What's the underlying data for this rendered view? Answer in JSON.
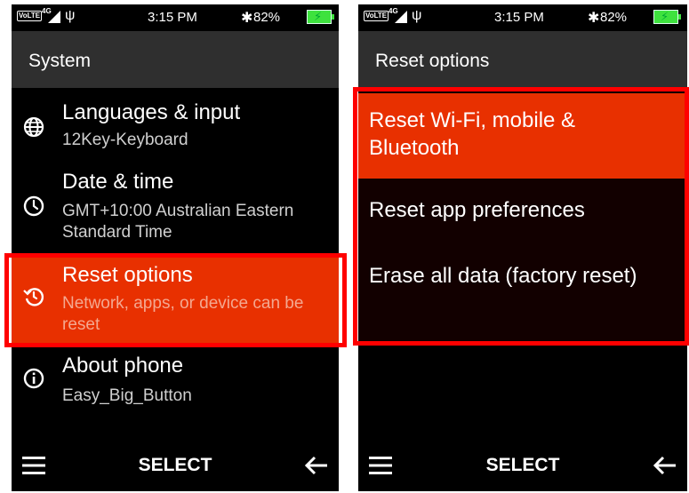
{
  "status_bar": {
    "volte": "VoLTE",
    "network": "4G",
    "time": "3:15 PM",
    "battery_percent": "82%",
    "battery_level": 0.82,
    "battery_color": "#3ee23e"
  },
  "left_screen": {
    "title": "System",
    "items": [
      {
        "title": "Languages & input",
        "subtitle": "12Key-Keyboard",
        "icon": "globe-icon"
      },
      {
        "title": "Date & time",
        "subtitle": "GMT+10:00 Australian Eastern Standard Time",
        "icon": "clock-icon"
      },
      {
        "title": "Reset options",
        "subtitle": "Network, apps, or device can be reset",
        "icon": "reset-history-icon",
        "selected": true
      },
      {
        "title": "About phone",
        "subtitle": "Easy_Big_Button",
        "icon": "info-icon"
      }
    ]
  },
  "right_screen": {
    "title": "Reset options",
    "items": [
      {
        "label": "Reset Wi-Fi, mobile & Bluetooth",
        "selected": true
      },
      {
        "label": "Reset app preferences"
      },
      {
        "label": "Erase all data (factory reset)"
      }
    ]
  },
  "bottom_bar": {
    "select_label": "SELECT",
    "menu_icon": "menu-icon",
    "back_icon": "back-arrow-icon"
  },
  "colors": {
    "selected_bg": "#e83000",
    "header_bg": "#2f2f2f",
    "screen_bg": "#000000",
    "highlight_border": "#ff0000"
  }
}
